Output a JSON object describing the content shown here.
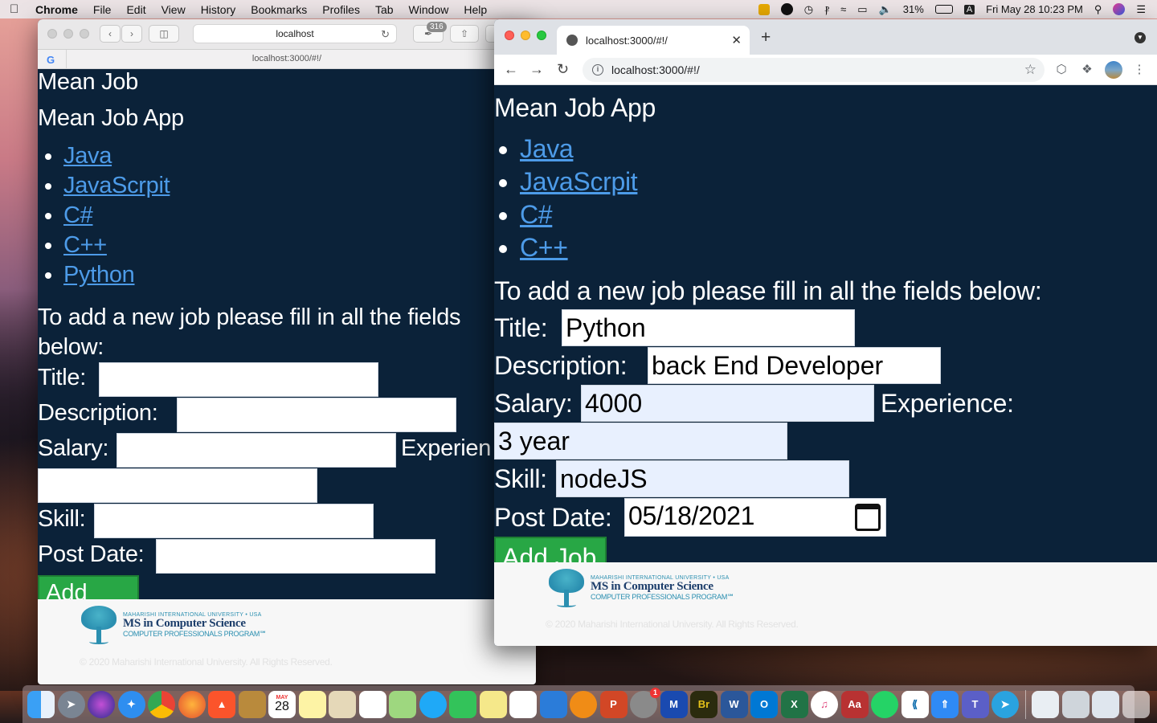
{
  "menubar": {
    "app_name": "Chrome",
    "items": [
      "File",
      "Edit",
      "View",
      "History",
      "Bookmarks",
      "Profiles",
      "Tab",
      "Window",
      "Help"
    ],
    "battery": "31%",
    "input_source": "A",
    "datetime": "Fri May 28  10:23 PM"
  },
  "safari": {
    "address": "localhost",
    "badge_count": "316",
    "tab_url": "localhost:3000/#!/",
    "page": {
      "heading": "Mean Job",
      "subheading": "Mean Job App",
      "links": [
        "Java",
        "JavaScrpit",
        "C#",
        "C++",
        "Python"
      ],
      "instructions": "To add a new job please fill in all the fields below:",
      "labels": {
        "title": "Title:",
        "description": "Description:",
        "salary": "Salary:",
        "experience": "Experien",
        "skill": "Skill:",
        "post_date": "Post Date:"
      },
      "button": "Add Job",
      "footer": {
        "univ": "MAHARISHI INTERNATIONAL UNIVERSITY • USA",
        "program": "MS in Computer Science",
        "sub": "COMPUTER PROFESSIONALS PROGRAM℠",
        "copyright": "© 2020 Maharishi International University. All Rights Reserved."
      }
    }
  },
  "chrome": {
    "tab_title": "localhost:3000/#!/",
    "address": "localhost:3000/#!/",
    "page": {
      "subheading": "Mean Job App",
      "links": [
        "Java",
        "JavaScrpit",
        "C#",
        "C++"
      ],
      "instructions": "To add a new job please fill in all the fields below:",
      "labels": {
        "title": "Title:",
        "description": "Description:",
        "salary": "Salary:",
        "experience": "Experience:",
        "skill": "Skill:",
        "post_date": "Post Date:"
      },
      "values": {
        "title": "Python",
        "description": "back End Developer",
        "salary": "4000",
        "experience": "3 year",
        "skill": "nodeJS",
        "post_date": "05/18/2021"
      },
      "button": "Add Job",
      "footer": {
        "univ": "MAHARISHI INTERNATIONAL UNIVERSITY • USA",
        "program": "MS in Computer Science",
        "sub": "COMPUTER PROFESSIONALS PROGRAM℠",
        "copyright": "© 2020 Maharishi International University. All Rights Reserved."
      }
    }
  },
  "dock": {
    "calendar_day": "28",
    "calendar_month": "MAY",
    "notification_badge": "1",
    "bridge_label": "Br"
  },
  "colors": {
    "page_bg": "#0b2239",
    "link": "#4d9be8",
    "button": "#28a745",
    "autofill": "#e8f0fe"
  }
}
